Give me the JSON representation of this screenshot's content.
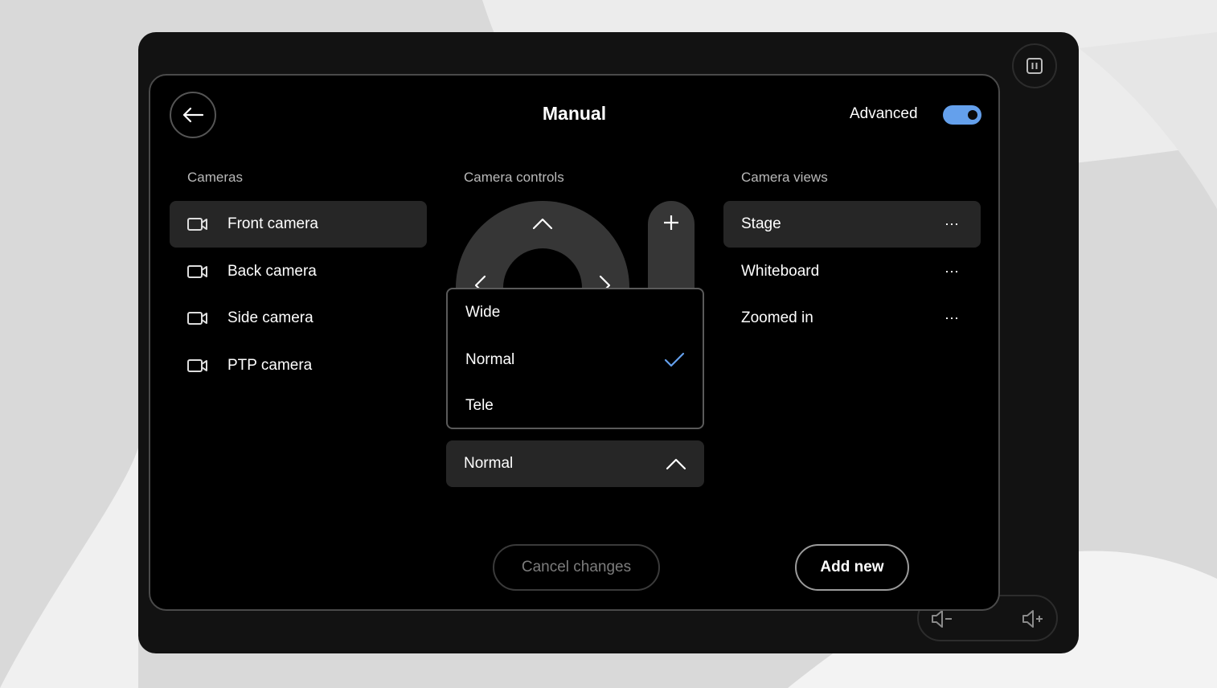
{
  "header": {
    "title": "Manual",
    "advanced_label": "Advanced",
    "advanced_enabled": true
  },
  "colors": {
    "accent": "#64a0ec",
    "panel_bg": "#000000",
    "selected_bg": "#262626"
  },
  "cameras": {
    "heading": "Cameras",
    "items": [
      {
        "label": "Front camera",
        "selected": true,
        "icon": "video-camera-icon"
      },
      {
        "label": "Back camera",
        "selected": false,
        "icon": "video-camera-icon"
      },
      {
        "label": "Side camera",
        "selected": false,
        "icon": "video-camera-icon"
      },
      {
        "label": "PTP camera",
        "selected": false,
        "icon": "video-camera-icon"
      }
    ]
  },
  "controls": {
    "heading": "Camera controls",
    "zoom_menu": {
      "options": [
        {
          "label": "Wide",
          "checked": false
        },
        {
          "label": "Normal",
          "checked": true
        },
        {
          "label": "Tele",
          "checked": false
        }
      ]
    },
    "zoom_select": {
      "value": "Normal"
    }
  },
  "views": {
    "heading": "Camera views",
    "items": [
      {
        "label": "Stage",
        "selected": true,
        "more": "⋯"
      },
      {
        "label": "Whiteboard",
        "selected": false,
        "more": "⋯"
      },
      {
        "label": "Zoomed in",
        "selected": false,
        "more": "⋯"
      }
    ]
  },
  "actions": {
    "cancel_label": "Cancel changes",
    "add_label": "Add new"
  }
}
